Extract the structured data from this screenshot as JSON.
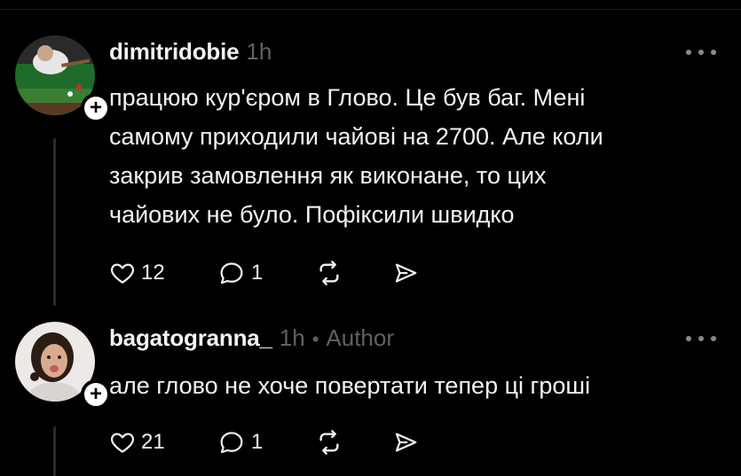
{
  "posts": [
    {
      "username": "dimitridobie",
      "time": "1h",
      "author_tag": "",
      "text": "працюю кур'єром в Глово. Це був баг. Мені\nсамому приходили чайові на 2700. Але коли\nзакрив замовлення як виконане, то цих\nчайових не було. Пофіксили швидко",
      "likes": "12",
      "replies": "1",
      "follow_symbol": "+"
    },
    {
      "username": "bagatogranna_",
      "time": "1h",
      "separator": "•",
      "author_tag": "Author",
      "text": "але глово не хоче повертати тепер ці гроші",
      "likes": "21",
      "replies": "1",
      "follow_symbol": "+"
    }
  ],
  "icons": {
    "like": "heart-icon",
    "reply": "comment-icon",
    "repost": "repost-icon",
    "share": "send-icon",
    "more": "more-icon"
  },
  "colors": {
    "background": "#000000",
    "text": "#f3f3f3",
    "muted": "#616161",
    "thread_line": "#2b2b2b"
  }
}
